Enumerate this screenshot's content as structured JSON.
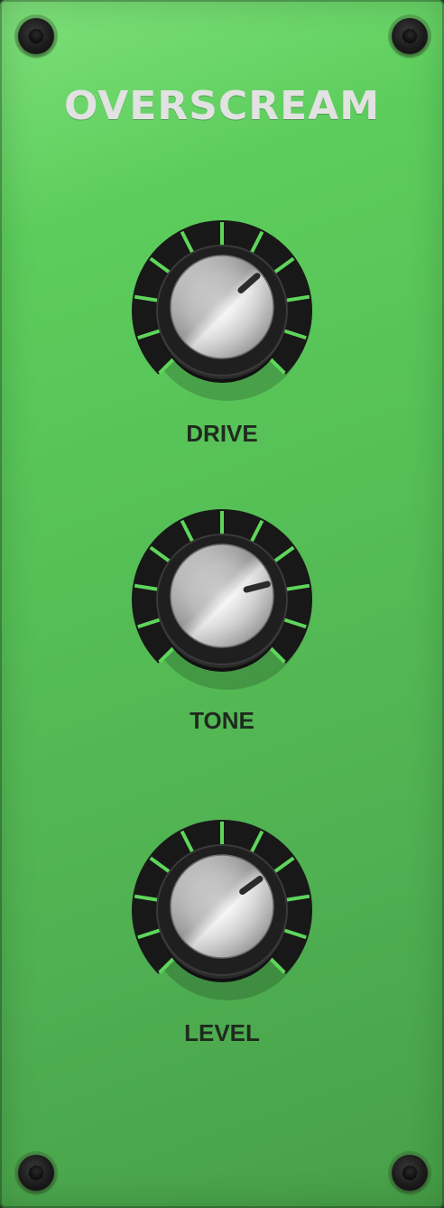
{
  "title": "OVERSCREAM",
  "colors": {
    "panel": "#56bf56",
    "tick": "#5ed65b",
    "knob_ring": "#1a1a1a",
    "label": "#1f2a1f",
    "title": "#e2e2e2"
  },
  "knobs": [
    {
      "label": "DRIVE",
      "value": 0.68
    },
    {
      "label": "TONE",
      "value": 0.78
    },
    {
      "label": "LEVEL",
      "value": 0.7
    }
  ],
  "screws": [
    "screw-top-left",
    "screw-top-right",
    "screw-bottom-left",
    "screw-bottom-right"
  ]
}
